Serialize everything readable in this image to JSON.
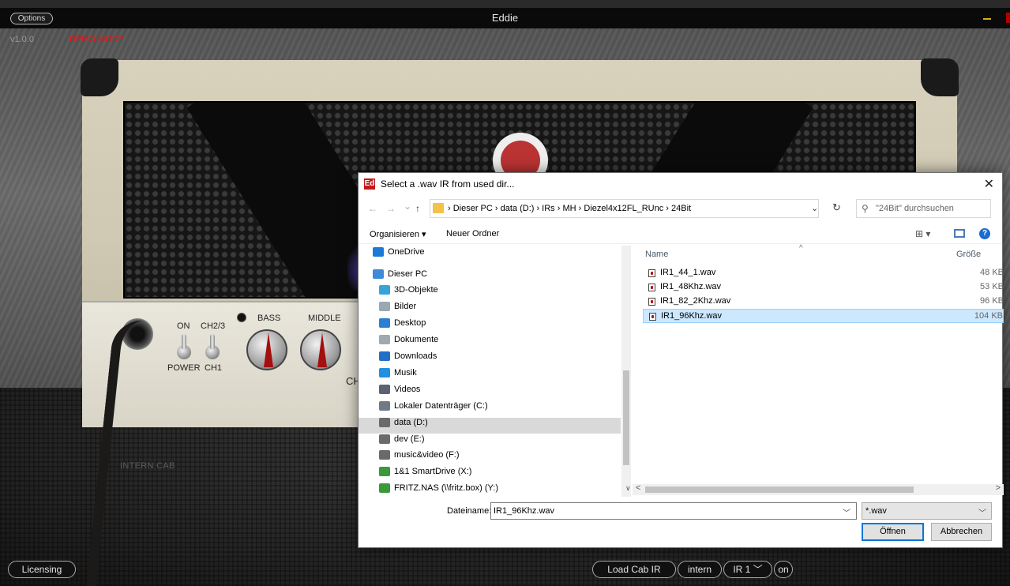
{
  "app": {
    "title": "Eddie",
    "options_label": "Options",
    "version": "v1.0.0",
    "mode": "DEMO MODE"
  },
  "amp": {
    "labels": {
      "on": "ON",
      "ch23": "CH2/3",
      "power": "POWER",
      "ch1": "CH1",
      "bass": "BASS",
      "middle": "MIDDLE",
      "ch_partial": "CH"
    },
    "cab_label": "INTERN CAB"
  },
  "bottom_bar": {
    "licensing": "Licensing",
    "load_cab_ir": "Load Cab IR",
    "intern": "intern",
    "ir_select": "IR 1",
    "on": "on"
  },
  "dialog": {
    "title": "Select a .wav IR from used dir...",
    "title_icon_text": "Ed",
    "close": "✕",
    "nav": {
      "back": "←",
      "forward": "→",
      "recent": "⌄",
      "up": "↑"
    },
    "breadcrumb": "›  Dieser PC  ›  data (D:)  ›  IRs  ›  MH  ›  Diezel4x12FL_RUnc  ›  24Bit",
    "address_dropdown": "⌄",
    "refresh": "↻",
    "search_placeholder": "\"24Bit\" durchsuchen",
    "organize": "Organisieren ▾",
    "new_folder": "Neuer Ordner",
    "view_icon": "⊞ ▾",
    "help": "?",
    "nav_items": [
      {
        "label": "OneDrive",
        "color": "#1e78d6"
      },
      {
        "label": "Dieser PC",
        "color": "#3c8ad8"
      },
      {
        "label": "3D-Objekte",
        "color": "#35a5d8"
      },
      {
        "label": "Bilder",
        "color": "#9aa7b4"
      },
      {
        "label": "Desktop",
        "color": "#2a7fd4"
      },
      {
        "label": "Dokumente",
        "color": "#a0a8b0"
      },
      {
        "label": "Downloads",
        "color": "#2070c8"
      },
      {
        "label": "Musik",
        "color": "#2090e0"
      },
      {
        "label": "Videos",
        "color": "#5a6470"
      },
      {
        "label": "Lokaler Datenträger (C:)",
        "color": "#707a84"
      },
      {
        "label": "data (D:)",
        "color": "#6a6a6a"
      },
      {
        "label": "dev (E:)",
        "color": "#6a6a6a"
      },
      {
        "label": "music&video (F:)",
        "color": "#6a6a6a"
      },
      {
        "label": "1&1 SmartDrive (X:)",
        "color": "#3a9a3a"
      },
      {
        "label": "FRITZ.NAS (\\\\fritz.box) (Y:)",
        "color": "#3a9a3a"
      }
    ],
    "columns": {
      "name": "Name",
      "size": "Größe",
      "sort_indicator": "^"
    },
    "files": [
      {
        "name": "IR1_44_1.wav",
        "size": "48 KB",
        "selected": false
      },
      {
        "name": "IR1_48Khz.wav",
        "size": "53 KB",
        "selected": false
      },
      {
        "name": "IR1_82_2Khz.wav",
        "size": "96 KB",
        "selected": false
      },
      {
        "name": "IR1_96Khz.wav",
        "size": "104 KB",
        "selected": true
      }
    ],
    "scroll": {
      "left": "<",
      "right": ">",
      "v_arrows": "∨"
    },
    "filename_label": "Dateiname:",
    "filename_value": "IR1_96Khz.wav",
    "filetype": "*.wav",
    "open": "Öffnen",
    "cancel": "Abbrechen"
  },
  "colors": {
    "accent": "#0078d7",
    "selection": "#cce8ff",
    "demo": "#ee1111"
  }
}
